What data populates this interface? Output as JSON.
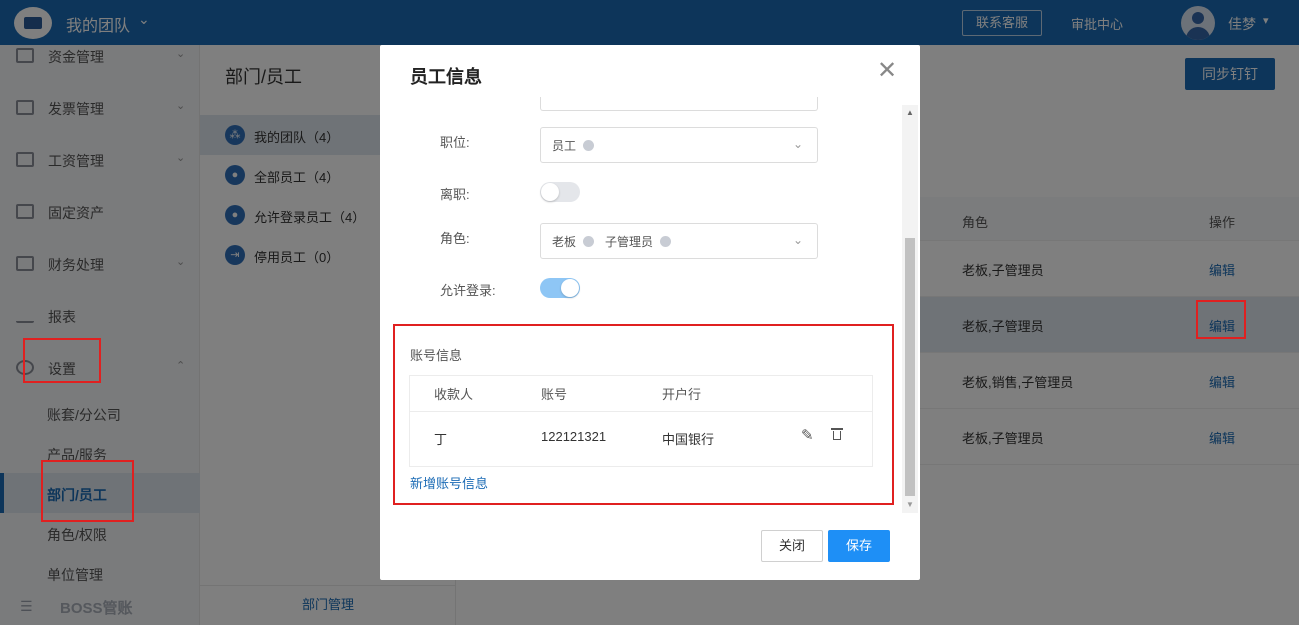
{
  "header": {
    "team_name": "我的团队",
    "contact_service": "联系客服",
    "approval_center": "审批中心",
    "user_name": "佳梦"
  },
  "sidebar": {
    "items": [
      {
        "label": "资金管理"
      },
      {
        "label": "发票管理"
      },
      {
        "label": "工资管理"
      },
      {
        "label": "固定资产"
      },
      {
        "label": "财务处理"
      },
      {
        "label": "报表"
      },
      {
        "label": "设置"
      }
    ],
    "sub_items": [
      {
        "label": "账套/分公司"
      },
      {
        "label": "产品/服务"
      },
      {
        "label": "部门/员工"
      },
      {
        "label": "角色/权限"
      },
      {
        "label": "单位管理"
      }
    ],
    "footer_label": "BOSS管账"
  },
  "dept_panel": {
    "title": "部门/员工",
    "items": [
      {
        "label": "我的团队（4）"
      },
      {
        "label": "全部员工（4）"
      },
      {
        "label": "允许登录员工（4）"
      },
      {
        "label": "停用员工（0）"
      }
    ],
    "footer": "部门管理"
  },
  "main": {
    "sync_button": "同步钉钉",
    "columns": {
      "role": "角色",
      "ops": "操作"
    },
    "rows": [
      {
        "role": "老板,子管理员",
        "edit": "编辑"
      },
      {
        "role": "老板,子管理员",
        "edit": "编辑"
      },
      {
        "role": "老板,销售,子管理员",
        "edit": "编辑"
      },
      {
        "role": "老板,子管理员",
        "edit": "编辑"
      }
    ]
  },
  "modal": {
    "title": "员工信息",
    "fields": {
      "position_label": "职位:",
      "position_value": "员工",
      "resigned_label": "离职:",
      "role_label": "角色:",
      "role_tags": [
        "老板",
        "子管理员"
      ],
      "allow_login_label": "允许登录:"
    },
    "toggles": {
      "resigned": false,
      "allow_login": true
    },
    "account_section": {
      "title": "账号信息",
      "headers": {
        "payee": "收款人",
        "account": "账号",
        "bank": "开户行"
      },
      "rows": [
        {
          "payee": "丁",
          "account": "122121321",
          "bank": "中国银行"
        }
      ],
      "add_link": "新增账号信息"
    },
    "buttons": {
      "close": "关闭",
      "save": "保存"
    }
  },
  "colors": {
    "brand": "#1b6bb5",
    "primary_button": "#1e8ff6",
    "annotation": "#e02020"
  }
}
